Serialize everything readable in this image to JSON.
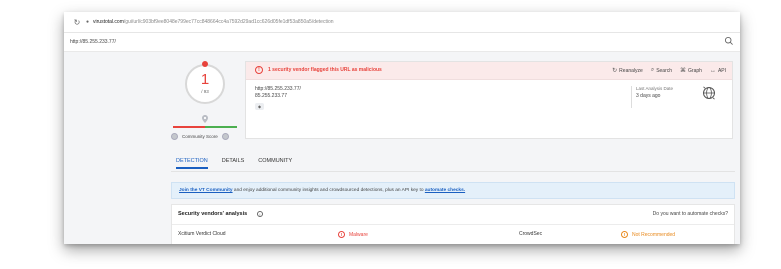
{
  "browser": {
    "host": "virustotal.com",
    "path": "/gui/url/c903bf9ee8048e799ec77cc848664cc4a7592d29ad1cc626d05fe1df53a850a5/detection"
  },
  "search": {
    "query": "http://85.255.233.77/"
  },
  "score": {
    "detections": "1",
    "total": "/ 93",
    "community_label": "Community Score"
  },
  "alert": {
    "text": "1 security vendor flagged this URL as malicious"
  },
  "actions": [
    {
      "label": "Reanalyze",
      "icon": "reanalyze-icon"
    },
    {
      "label": "Search",
      "icon": "search-icon"
    },
    {
      "label": "Graph",
      "icon": "graph-icon"
    },
    {
      "label": "API",
      "icon": "api-icon"
    }
  ],
  "target": {
    "url": "http://85.255.233.77/",
    "host": "85.255.233.77"
  },
  "analysis": {
    "label": "Last Analysis Date",
    "value": "3 days ago"
  },
  "tabs": [
    "DETECTION",
    "DETAILS",
    "COMMUNITY"
  ],
  "banner": {
    "link1": "Join the VT Community",
    "middle": " and enjoy additional community insights and crowdsourced detections, plus an API key to ",
    "link2": "automate checks."
  },
  "vendors": {
    "title": "Security vendors' analysis",
    "automate": "Do you want to automate checks?",
    "rows": [
      {
        "vendor1": "Xcitium Verdict Cloud",
        "verdict1": "Malware",
        "vendor2": "CrowdSec",
        "verdict2": "Not Recommended"
      }
    ]
  },
  "colors": {
    "malicious": "#e8433c",
    "warning": "#e8891c",
    "link": "#1a5fc1",
    "banner_bg": "#e4f0fa"
  }
}
